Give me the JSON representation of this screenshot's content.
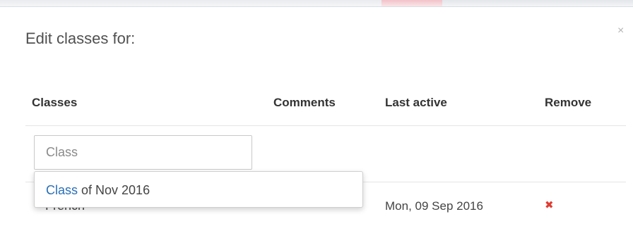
{
  "modal": {
    "title": "Edit classes for:",
    "close_symbol": "×"
  },
  "table": {
    "headers": {
      "classes": "Classes",
      "comments": "Comments",
      "last_active": "Last active",
      "remove": "Remove"
    },
    "class_input": {
      "placeholder": "Class",
      "value": ""
    },
    "rows": [
      {
        "class_name": "French",
        "last_active": "Mon, 09 Sep 2016",
        "remove_symbol": "✖"
      }
    ]
  },
  "autocomplete": {
    "items": [
      {
        "match": "Class",
        "rest": " of Nov 2016"
      }
    ]
  },
  "colors": {
    "remove_icon": "#e03c31",
    "autocomplete_match": "#2a6fb8"
  },
  "icons": {
    "close": "close-icon",
    "remove": "remove-icon"
  }
}
